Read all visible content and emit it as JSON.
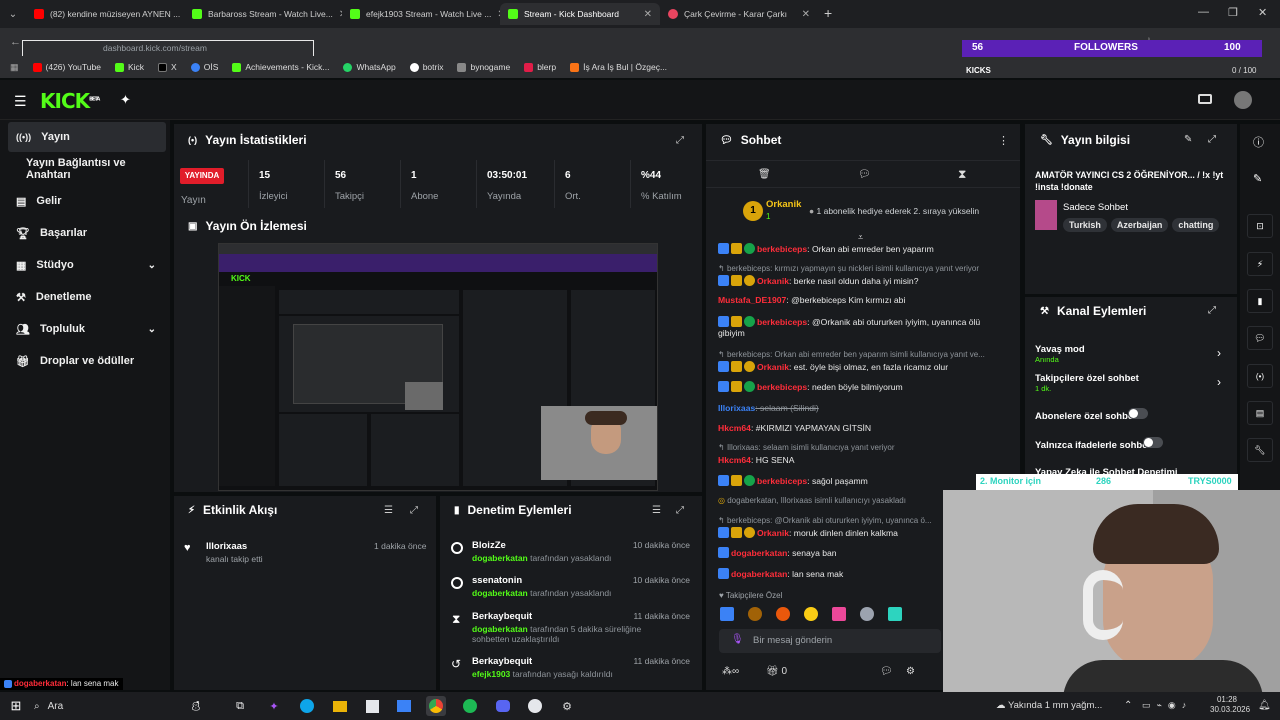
{
  "browser": {
    "tabs": [
      {
        "title": "(82) kendine müziseyen AYNEN ...",
        "color": "#ff0000"
      },
      {
        "title": "Barbaross Stream - Watch Live...",
        "color": "#53fc18"
      },
      {
        "title": "efejk1903 Stream - Watch Live ...",
        "color": "#53fc18"
      },
      {
        "title": "Stream - Kick Dashboard",
        "color": "#53fc18"
      },
      {
        "title": "Çark Çevirme - Karar Çarkı",
        "color": "#e94560"
      }
    ],
    "url": "dashboard.kick.com/stream",
    "bookmarks": [
      "(426) YouTube",
      "Kick",
      "X",
      "OİS",
      "Achievements - Kick...",
      "WhatsApp",
      "botrix",
      "bynogame",
      "blerp",
      "İş Ara İş Bul | Özgeç..."
    ]
  },
  "overlay": {
    "followers_count": "56",
    "followers_label": "FOLLOWERS",
    "kicks_label": "KICKS",
    "kicks_count": "100",
    "kicks_progress": "0 / 100"
  },
  "header": {
    "logo": "KICK",
    "logo_sup": "BETA"
  },
  "sidebar": {
    "items": [
      {
        "label": "Yayın"
      },
      {
        "label": "Yayın Bağlantısı ve Anahtarı"
      },
      {
        "label": "Gelir"
      },
      {
        "label": "Başarılar"
      },
      {
        "label": "Stüdyo"
      },
      {
        "label": "Denetleme"
      },
      {
        "label": "Topluluk"
      },
      {
        "label": "Droplar ve ödüller"
      }
    ]
  },
  "stats": {
    "title": "Yayın İstatistikleri",
    "live_badge": "YAYINDA",
    "live_label": "Yayın",
    "items": [
      {
        "value": "15",
        "label": "İzleyici"
      },
      {
        "value": "56",
        "label": "Takipçi"
      },
      {
        "value": "1",
        "label": "Abone"
      },
      {
        "value": "03:50:01",
        "label": "Yayında"
      },
      {
        "value": "6",
        "label": "Ort."
      },
      {
        "value": "%44",
        "label": "% Katılım"
      }
    ]
  },
  "preview": {
    "title": "Yayın Ön İzlemesi"
  },
  "activity": {
    "title": "Etkinlik Akışı",
    "items": [
      {
        "name": "Illorixaas",
        "desc": "kanalı takip etti",
        "time": "1 dakika önce"
      }
    ]
  },
  "moderation": {
    "title": "Denetim Eylemleri",
    "items": [
      {
        "name": "BloizZe",
        "mod": "dogaberkatan",
        "desc": "tarafından yasaklandı",
        "time": "10 dakika önce"
      },
      {
        "name": "ssenatonin",
        "mod": "dogaberkatan",
        "desc": "tarafından yasaklandı",
        "time": "10 dakika önce"
      },
      {
        "name": "Berkaybequit",
        "mod": "dogaberkatan",
        "desc": "tarafından 5 dakika süreliğine sohbetten uzaklaştırıldı",
        "time": "11 dakika önce"
      },
      {
        "name": "Berkaybequit",
        "mod": "efejk1903",
        "desc": "tarafından yasağı kaldırıldı",
        "time": "11 dakika önce"
      }
    ]
  },
  "chat": {
    "title": "Sohbet",
    "pinned_user": "Orkanik",
    "pinned_sub": "1",
    "pinned_text": "1 abonelik hediye ederek 2. sıraya yükselin",
    "messages": [
      {
        "user": "berkebiceps",
        "text": ": Orkan abi emreder ben yaparım",
        "reply": ""
      },
      {
        "user": "Orkanik",
        "text": ": berke nasıl oldun daha iyi misin?",
        "reply": "berkebiceps: kırmızı yapmayın şu nickleri isimli kullanıcıya yanıt veriyor"
      },
      {
        "user": "Mustafa_DE1907",
        "text": ": @berkebiceps Kim kırmızı abi",
        "reply": ""
      },
      {
        "user": "berkebiceps",
        "text": ": @Orkanik abi otururken iyiyim, uyanınca ölü gibiyim",
        "reply": ""
      },
      {
        "user": "Orkanik",
        "text": ": est. öyle bişi olmaz, en fazla ricamız olur",
        "reply": "berkebiceps: Orkan abi emreder ben yaparım isimli kullanıcıya yanıt ve..."
      },
      {
        "user": "berkebiceps",
        "text": ": neden böyle bilmiyorum",
        "reply": ""
      },
      {
        "user": "Illorixaas",
        "text": ": selaam (Silindi)",
        "reply": ""
      },
      {
        "user": "Hkcm64",
        "text": ": #KIRMIZI YAPMAYAN GİTSİN",
        "reply": ""
      },
      {
        "user": "Hkcm64",
        "text": ": HG SENA",
        "reply": "Illorixaas: selaam isimli kullanıcıya yanıt veriyor"
      },
      {
        "user": "berkebiceps",
        "text": ": sağol paşamm",
        "reply": ""
      },
      {
        "user": "Orkanik",
        "text": ": moruk dinlen dinlen kalkma",
        "reply": "berkebiceps: @Orkanik abi otururken iyiyim, uyanınca ö..."
      },
      {
        "user": "dogaberkatan",
        "text": ": senaya ban",
        "reply": ""
      },
      {
        "user": "dogaberkatan",
        "text": ": lan sena mak",
        "reply": ""
      }
    ],
    "system_msg": "dogaberkatan, Illorixaas isimli kullanıcıyı yasakladı",
    "followers_only": "Takipçilere Özel",
    "input_placeholder": "Bir mesaj gönderin",
    "footer_count": "0",
    "footer_inf": "∞"
  },
  "stream_info": {
    "title": "Yayın bilgisi",
    "stream_title": "AMATÖR YAYINCI CS 2 ÖĞRENİYOR... / !x !yt !insta !donate",
    "category": "Sadece Sohbet",
    "tags": [
      "Turkish",
      "Azerbaijan",
      "chatting"
    ]
  },
  "channel_actions": {
    "title": "Kanal Eylemleri",
    "items": [
      {
        "label": "Yavaş mod",
        "sub": "Anında",
        "type": "arrow"
      },
      {
        "label": "Takipçilere özel sohbet",
        "sub": "1 dk.",
        "type": "arrow"
      },
      {
        "label": "Abonelere özel sohbet",
        "sub": "",
        "type": "toggle"
      },
      {
        "label": "Yalnızca ifadelerle sohbet",
        "sub": "",
        "type": "toggle"
      },
      {
        "label": "Yapay Zeka ile Sohbet Denetimi",
        "sub": "",
        "type": "link"
      }
    ]
  },
  "monitor_overlay": {
    "label": "2. Monitor için",
    "num": "286",
    "name": "TRYS0000"
  },
  "bottom_chat": {
    "user": "dogaberkatan",
    "text": ": lan sena mak"
  },
  "taskbar": {
    "search": "Ara",
    "weather": "Yakında 1 mm yağm...",
    "time": "01:28",
    "date": "30.03.2026"
  },
  "colors": {
    "kick_green": "#53fc18",
    "live_red": "#e11d2a",
    "mod_red": "#ff2d3a"
  }
}
